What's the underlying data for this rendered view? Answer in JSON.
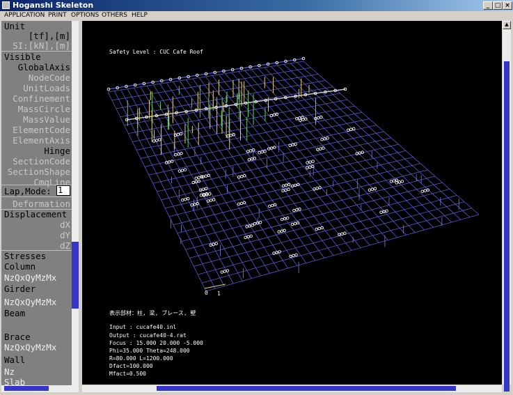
{
  "window": {
    "title": "Hoganshi Skeleton",
    "min_glyph": "_",
    "max_glyph": "□",
    "close_glyph": "×"
  },
  "menu": {
    "items": [
      "APPLICATION",
      "PRINT",
      "OPTIONS",
      "OTHERS",
      "HELP"
    ]
  },
  "sidebar": {
    "unit_label": "Unit",
    "unit_tf": "[tf],[m]",
    "unit_si": "SI:[kN],[m]",
    "visible_label": "Visible",
    "visible_items": [
      "GlobalAxis",
      "NodeCode",
      "UnitLoads",
      "Confinement",
      "MassCircle",
      "MassValue",
      "ElementCode",
      "ElementAxis",
      "Hinge",
      "SectionCode",
      "SectionShape",
      "CmqLine"
    ],
    "lap_mode_label": "Lap,Mode:",
    "lap_mode_value": "1",
    "deformation": "Deformation",
    "displacement_label": "Displacement",
    "displacement_items": [
      "dX",
      "dY",
      "dZ"
    ],
    "stresses_label": "Stresses",
    "column_label": "Column",
    "column_components": "NzQxQyMzMx",
    "girder_label": "Girder",
    "girder_components": "NzQxQyMzMx",
    "beam_label": "Beam",
    "brace_label": "Brace",
    "brace_components": "NzQxQyMzMx",
    "wall_label": "Wall",
    "wall_components": "Nz",
    "slab_label": "Slab"
  },
  "viewport": {
    "safety_level": "Safety Level : CUC Cafe Roof",
    "members_shown": "表示部材：柱, 梁, ブレース, 壁",
    "input_file": "Input  : cucafe40.inl",
    "output_file": "Output : cucafe40-4.rat",
    "focus": "Focus : 15.000 20.000 -5.000",
    "phi_theta": "Phi=35.000 Theta=248.000",
    "r_l": "R=80.000 L=1200.000",
    "dfact": "Dfact=100.000",
    "mfact": "Mfact=0.500",
    "axis_label_0": "0",
    "axis_label_1": "1"
  },
  "colors": {
    "grid": "#5a5ad2",
    "node": "#ffffff",
    "column": "#e8d070",
    "column_alt": "#60d060",
    "background": "#000000",
    "panel": "#808080",
    "scroll_thumb": "#3535c8"
  }
}
